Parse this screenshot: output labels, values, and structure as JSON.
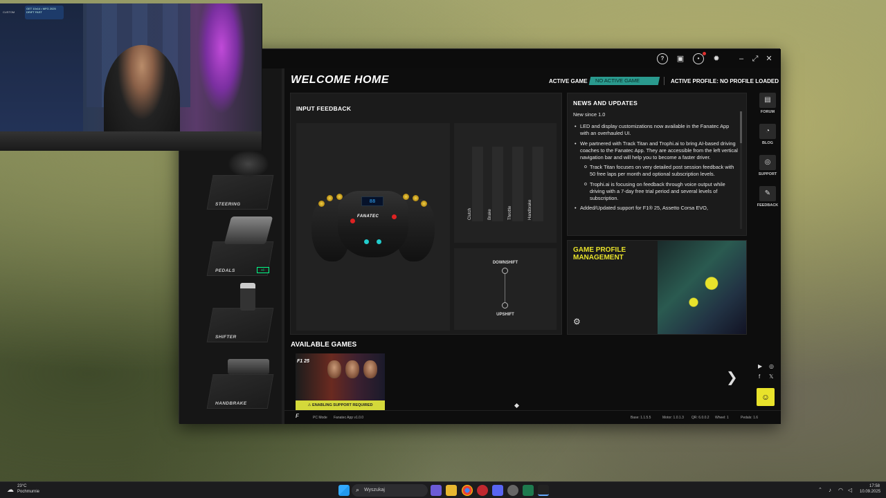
{
  "webcam": {
    "sticker_text": "GET 10x14 • MFG 2025 DRIFT FAST",
    "label": "CUSTOM"
  },
  "window": {
    "icons": [
      "help-icon",
      "devices-icon",
      "notifications-icon",
      "settings-icon"
    ],
    "controls": {
      "minimize": "–",
      "maximize": "⤢",
      "close": "✕"
    }
  },
  "leftnav": {
    "items": [
      {
        "label": "STEERING"
      },
      {
        "label": "PEDALS",
        "badge": "+/-"
      },
      {
        "label": "SHIFTER"
      },
      {
        "label": "HANDBRAKE"
      }
    ]
  },
  "header": {
    "title": "WELCOME HOME",
    "active_game_label": "ACTIVE GAME",
    "active_game_value": "NO ACTIVE GAME",
    "active_profile_label": "ACTIVE PROFILE:",
    "active_profile_value": "NO PROFILE LOADED"
  },
  "input_feedback": {
    "title": "INPUT FEEDBACK",
    "wheel_brand": "FANATEC",
    "wheel_display": "88",
    "bars": [
      {
        "label": "Clutch",
        "level": 0
      },
      {
        "label": "Brake",
        "level": 0
      },
      {
        "label": "Throttle",
        "level": 0
      },
      {
        "label": "Handbrake",
        "level": 0
      }
    ],
    "downshift": "DOWNSHIFT",
    "upshift": "UPSHIFT"
  },
  "news": {
    "title": "NEWS AND UPDATES",
    "subtitle": "New since 1.0",
    "items": [
      "LED and display customizations now available in the Fanatec App with an overhauled UI.",
      "We partnered with Track Titan and Trophi.ai to bring AI-based driving coaches to the Fanatec App. They are accessible from the left vertical navigation bar and will help you to become a faster driver."
    ],
    "subitems": [
      "Track Titan focuses on very detailed post session feedback with 50 free laps per month and optional subscription levels.",
      "Trophi.ai is focusing on feedback through voice output while driving with a 7-day free trial period and several levels of subscription."
    ],
    "last_item": "Added/Updated support for F1® 25, Assetto Corsa EVO,"
  },
  "game_profile": {
    "title": "GAME PROFILE MANAGEMENT"
  },
  "side_links": [
    {
      "label": "FORUM",
      "icon": "forum-icon",
      "glyph": "▤"
    },
    {
      "label": "BLOG",
      "icon": "rss-icon",
      "glyph": "◔"
    },
    {
      "label": "SUPPORT",
      "icon": "support-icon",
      "glyph": "◎"
    },
    {
      "label": "FEEDBACK",
      "icon": "feedback-icon",
      "glyph": "✎"
    }
  ],
  "games": {
    "title": "AVAILABLE GAMES",
    "prev": "❮",
    "next": "❯",
    "cards": [
      {
        "name": "F1 25",
        "warning": "⚠ ENABLING SUPPORT REQUIRED"
      }
    ]
  },
  "social": {
    "youtube": "▶",
    "instagram": "◎",
    "facebook": "f",
    "x": "𝕏"
  },
  "statusbar": {
    "pc_mode": "PC Mode",
    "app_version": "Fanatec App v1.0.0",
    "base": "Base: 1.1.5.5",
    "motor": "Motor: 1.0.1.3",
    "qr": "QR: 6.0.0.2",
    "wheel": "Wheel: 1",
    "pedals": "Pedals: 1.6"
  },
  "taskbar": {
    "weather_temp": "23°C",
    "weather_desc": "Pochmurnie",
    "search_placeholder": "Wyszukaj",
    "time": "17:58",
    "date": "10.09.2025"
  }
}
